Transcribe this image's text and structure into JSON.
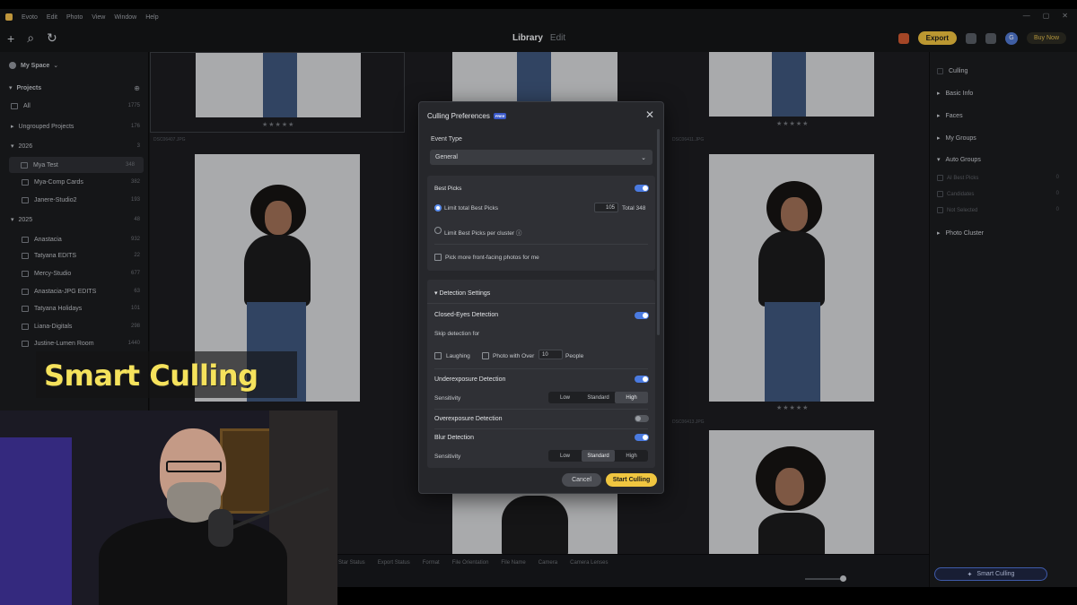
{
  "menu": [
    "Evoto",
    "Edit",
    "Photo",
    "View",
    "Window",
    "Help"
  ],
  "toolbar": {
    "tab_library": "Library",
    "tab_edit": "Edit",
    "export_label": "Export",
    "buy_label": "Buy Now",
    "avatar_initial": "G"
  },
  "sidebar": {
    "space": "My Space",
    "projects": "Projects",
    "rows": [
      {
        "label": "All",
        "count": "1775"
      },
      {
        "label": "Ungrouped Projects",
        "count": "176"
      },
      {
        "label": "2026",
        "count": "3"
      },
      {
        "label": "Mya Test",
        "count": "348"
      },
      {
        "label": "Mya-Comp Cards",
        "count": "382"
      },
      {
        "label": "Janere-Studio2",
        "count": "193"
      },
      {
        "label": "2025",
        "count": "48"
      },
      {
        "label": "Anastacia",
        "count": "932"
      },
      {
        "label": "Tatyana EDITS",
        "count": "22"
      },
      {
        "label": "Mercy-Studio",
        "count": "677"
      },
      {
        "label": "Anastacia-JPG EDITS",
        "count": "63"
      },
      {
        "label": "Tatyana Holidays",
        "count": "101"
      },
      {
        "label": "Liana-Digitals",
        "count": "298"
      },
      {
        "label": "Justine-Lumen Room",
        "count": "1440"
      }
    ]
  },
  "grid": {
    "stars": "★★★★★",
    "labels": [
      "DSC06407.JPG",
      "DSC06411.JPG",
      "DSC06413.JPG"
    ]
  },
  "filters": [
    "Star Status",
    "Export Status",
    "Format",
    "File Orientation",
    "File Name",
    "Camera",
    "Camera Lenses"
  ],
  "right_panel": {
    "culling": "Culling",
    "basic_info": "Basic Info",
    "faces": "Faces",
    "my_groups": "My Groups",
    "auto_groups": "Auto Groups",
    "auto_items": [
      {
        "label": "AI Best Picks",
        "count": "0"
      },
      {
        "label": "Candidates",
        "count": "0"
      },
      {
        "label": "Not Selected",
        "count": "0"
      }
    ],
    "photo_cluster": "Photo Cluster",
    "smart_culling_btn": "Smart Culling"
  },
  "modal": {
    "title": "Culling Preferences",
    "badge": "FREE",
    "event_type_label": "Event Type",
    "event_type_value": "General",
    "best_picks": "Best Picks",
    "limit_total": "Limit total Best Picks",
    "limit_total_value": "105",
    "total_text": "Total 348",
    "limit_cluster": "Limit Best Picks per cluster",
    "front_facing": "Pick more front-facing photos for me",
    "detection_settings": "Detection Settings",
    "closed_eyes": "Closed-Eyes Detection",
    "skip_for": "Skip detection for",
    "laughing": "Laughing",
    "photo_with_over": "Photo with Over",
    "people_value": "10",
    "people": "People",
    "underexposure": "Underexposure Detection",
    "sensitivity": "Sensitivity",
    "seg": [
      "Low",
      "Standard",
      "High"
    ],
    "overexposure": "Overexposure Detection",
    "blur": "Blur Detection",
    "cancel": "Cancel",
    "start": "Start Culling"
  },
  "caption": "Smart Culling"
}
